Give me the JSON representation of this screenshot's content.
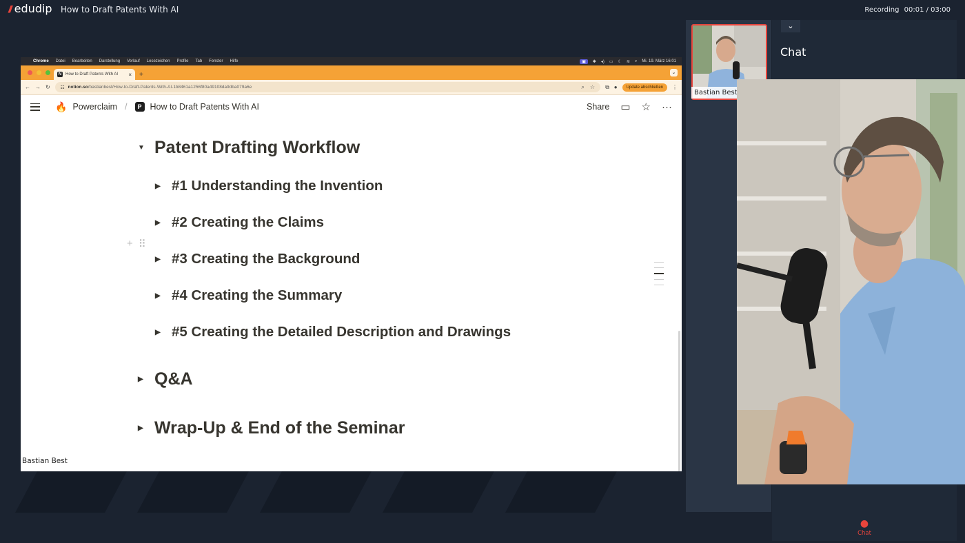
{
  "app": {
    "brand": "edudip",
    "event_title": "How to Draft Patents With AI",
    "recording_label": "Recording",
    "recording_time": "00:01 / 03:00"
  },
  "mac_menu": {
    "apple": "",
    "app": "Chrome",
    "items": [
      "Datei",
      "Bearbeiten",
      "Darstellung",
      "Verlauf",
      "Lesezeichen",
      "Profile",
      "Tab",
      "Fenster",
      "Hilfe"
    ],
    "clock": "Mi. 19. März 16:01"
  },
  "browser": {
    "tab_title": "How to Draft Patents With AI",
    "tab_icon": "N",
    "url_host": "notion.so",
    "url_path": "/bastianbest/How-to-Draft-Patents-With-AI-1b8461a1256f80a49108da9dba079a6e",
    "update_label": "Update abschließen"
  },
  "notion": {
    "breadcrumb_workspace": "Powerclaim",
    "breadcrumb_page": "How to Draft Patents With AI",
    "page_icon": "P",
    "share_label": "Share",
    "sections": {
      "workflow": "Patent Drafting Workflow",
      "step1": "#1 Understanding the Invention",
      "step2": "#2 Creating the Claims",
      "step3": "#3 Creating the Background",
      "step4": "#4 Creating the Summary",
      "step5": "#5 Creating the Detailed Description and Drawings",
      "qa": "Q&A",
      "wrapup": "Wrap-Up & End of the Seminar"
    }
  },
  "presenter": {
    "name": "Bastian Best"
  },
  "chat": {
    "title": "Chat",
    "tab_label": "Chat"
  },
  "colors": {
    "background": "#1b2330",
    "accent": "#e8453c",
    "browser_tab_bar": "#f5a236"
  }
}
